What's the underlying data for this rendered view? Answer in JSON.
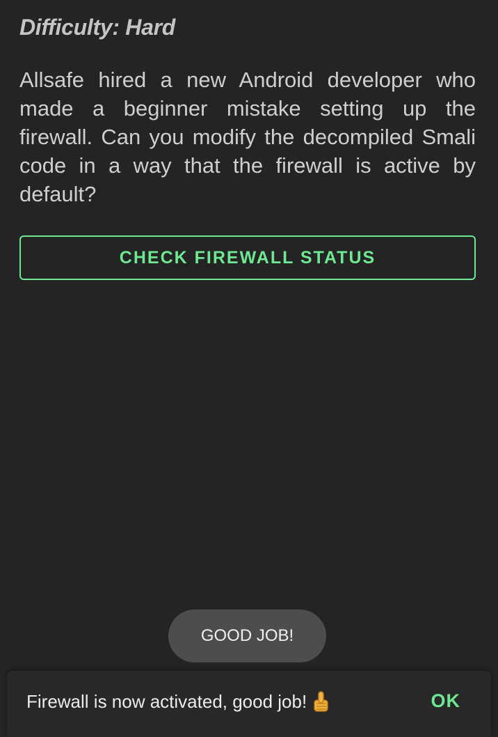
{
  "challenge": {
    "difficulty": "Difficulty: Hard",
    "description": "Allsafe hired a new Android developer who made a beginner mistake setting up the firewall. Can you modify the decompiled Smali code in a way that the firewall is active by default?",
    "check_button_label": "CHECK FIREWALL STATUS"
  },
  "toast": {
    "text": "GOOD JOB!"
  },
  "snackbar": {
    "message": "Firewall is now activated, good job!",
    "icon": "thumbs-up-icon",
    "action_label": "OK"
  },
  "colors": {
    "background": "#242424",
    "accent": "#6fe893",
    "toast_bg": "#4d4d4d"
  }
}
